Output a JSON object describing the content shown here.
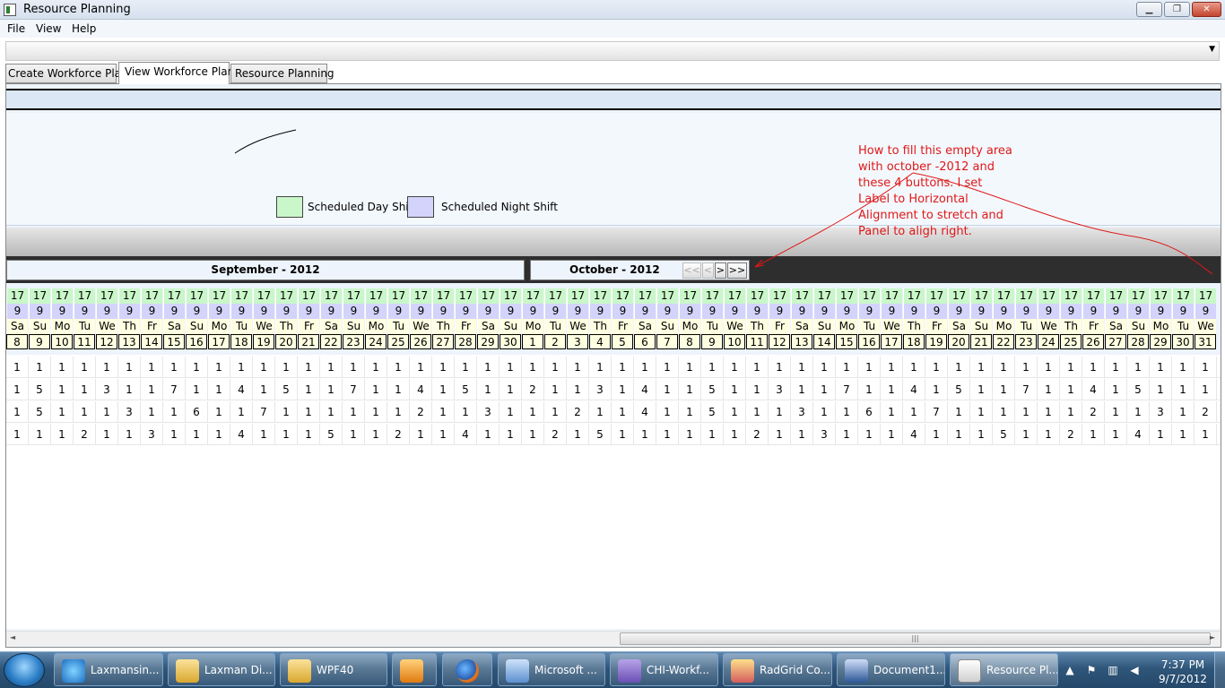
{
  "window": {
    "title": "Resource Planning",
    "buttons": {
      "minimize": "▁",
      "maximize": "❐",
      "close": "✕"
    }
  },
  "menu": [
    "File",
    "View",
    "Help"
  ],
  "tabs": [
    "Create Workforce Plan",
    "View Workforce Plan",
    "Resource Planning"
  ],
  "legend": {
    "day_shift": "Scheduled Day Shift",
    "night_shift": "Scheduled Night Shift",
    "day_color": "#c9f7c9",
    "night_color": "#d3d3fb"
  },
  "calendar": {
    "month1": "September - 2012",
    "month2": "October - 2012",
    "nav": [
      "<<",
      "<",
      ">",
      ">>"
    ],
    "row_start": "17",
    "row_end": "9",
    "day_names": [
      "Sa",
      "Su",
      "Mo",
      "Tu",
      "We",
      "Th",
      "Fr",
      "Sa",
      "Su",
      "Mo",
      "Tu",
      "We",
      "Th",
      "Fr",
      "Sa",
      "Su",
      "Mo",
      "Tu",
      "We",
      "Th",
      "Fr",
      "Sa",
      "Su",
      "Mo",
      "Tu",
      "We",
      "Th",
      "Fr",
      "Sa",
      "Su",
      "Mo",
      "Tu",
      "We",
      "Th",
      "Fr",
      "Sa",
      "Su",
      "Mo",
      "Tu",
      "We",
      "Th",
      "Fr",
      "Sa",
      "Su",
      "Mo",
      "Tu",
      "We",
      "Th",
      "Fr",
      "Sa",
      "Su",
      "Mo",
      "Tu",
      "We"
    ],
    "dates": [
      "8",
      "9",
      "10",
      "11",
      "12",
      "13",
      "14",
      "15",
      "16",
      "17",
      "18",
      "19",
      "20",
      "21",
      "22",
      "23",
      "24",
      "25",
      "26",
      "27",
      "28",
      "29",
      "30",
      "1",
      "2",
      "3",
      "4",
      "5",
      "6",
      "7",
      "8",
      "9",
      "10",
      "11",
      "12",
      "13",
      "14",
      "15",
      "16",
      "17",
      "18",
      "19",
      "20",
      "21",
      "22",
      "23",
      "24",
      "25",
      "26",
      "27",
      "28",
      "29",
      "30",
      "31"
    ]
  },
  "data_rows": [
    [
      "1",
      "1",
      "1",
      "1",
      "1",
      "1",
      "1",
      "1",
      "1",
      "1",
      "1",
      "1",
      "1",
      "1",
      "1",
      "1",
      "1",
      "1",
      "1",
      "1",
      "1",
      "1",
      "1",
      "1",
      "1",
      "1",
      "1",
      "1",
      "1",
      "1",
      "1",
      "1",
      "1",
      "1",
      "1",
      "1",
      "1",
      "1",
      "1",
      "1",
      "1",
      "1",
      "1",
      "1",
      "1",
      "1",
      "1",
      "1",
      "1",
      "1",
      "1",
      "1",
      "1",
      "1"
    ],
    [
      "1",
      "5",
      "1",
      "1",
      "3",
      "1",
      "1",
      "7",
      "1",
      "1",
      "4",
      "1",
      "5",
      "1",
      "1",
      "7",
      "1",
      "1",
      "4",
      "1",
      "5",
      "1",
      "1",
      "2",
      "1",
      "1",
      "3",
      "1",
      "4",
      "1",
      "1",
      "5",
      "1",
      "1",
      "3",
      "1",
      "1",
      "7",
      "1",
      "1",
      "4",
      "1",
      "5",
      "1",
      "1",
      "7",
      "1",
      "1",
      "4",
      "1",
      "5",
      "1",
      "1",
      "1"
    ],
    [
      "1",
      "5",
      "1",
      "1",
      "1",
      "3",
      "1",
      "1",
      "6",
      "1",
      "1",
      "7",
      "1",
      "1",
      "1",
      "1",
      "1",
      "1",
      "2",
      "1",
      "1",
      "3",
      "1",
      "1",
      "1",
      "2",
      "1",
      "1",
      "4",
      "1",
      "1",
      "5",
      "1",
      "1",
      "1",
      "3",
      "1",
      "1",
      "6",
      "1",
      "1",
      "7",
      "1",
      "1",
      "1",
      "1",
      "1",
      "1",
      "2",
      "1",
      "1",
      "3",
      "1",
      "2"
    ],
    [
      "1",
      "1",
      "1",
      "2",
      "1",
      "1",
      "3",
      "1",
      "1",
      "1",
      "4",
      "1",
      "1",
      "1",
      "5",
      "1",
      "1",
      "2",
      "1",
      "1",
      "4",
      "1",
      "1",
      "1",
      "2",
      "1",
      "5",
      "1",
      "1",
      "1",
      "1",
      "1",
      "1",
      "2",
      "1",
      "1",
      "3",
      "1",
      "1",
      "1",
      "4",
      "1",
      "1",
      "1",
      "5",
      "1",
      "1",
      "2",
      "1",
      "1",
      "4",
      "1",
      "1",
      "1"
    ]
  ],
  "annotation": "How to fill this empty area with october -2012 and these 4 buttons. I set Label to Horizontal Alignment to stretch and Panel to aligh right.",
  "scrollbar": {
    "grip": "|||",
    "left": "◄",
    "right": "►"
  },
  "taskbar": {
    "items": [
      "Laxmansin...",
      "Laxman Di...",
      "WPF40",
      "",
      "",
      "Microsoft ...",
      "CHI-Workf...",
      "RadGrid Co...",
      "Document1...",
      "Resource Pl..."
    ],
    "time": "7:37 PM",
    "date": "9/7/2012",
    "tray_arrow": "▲"
  }
}
